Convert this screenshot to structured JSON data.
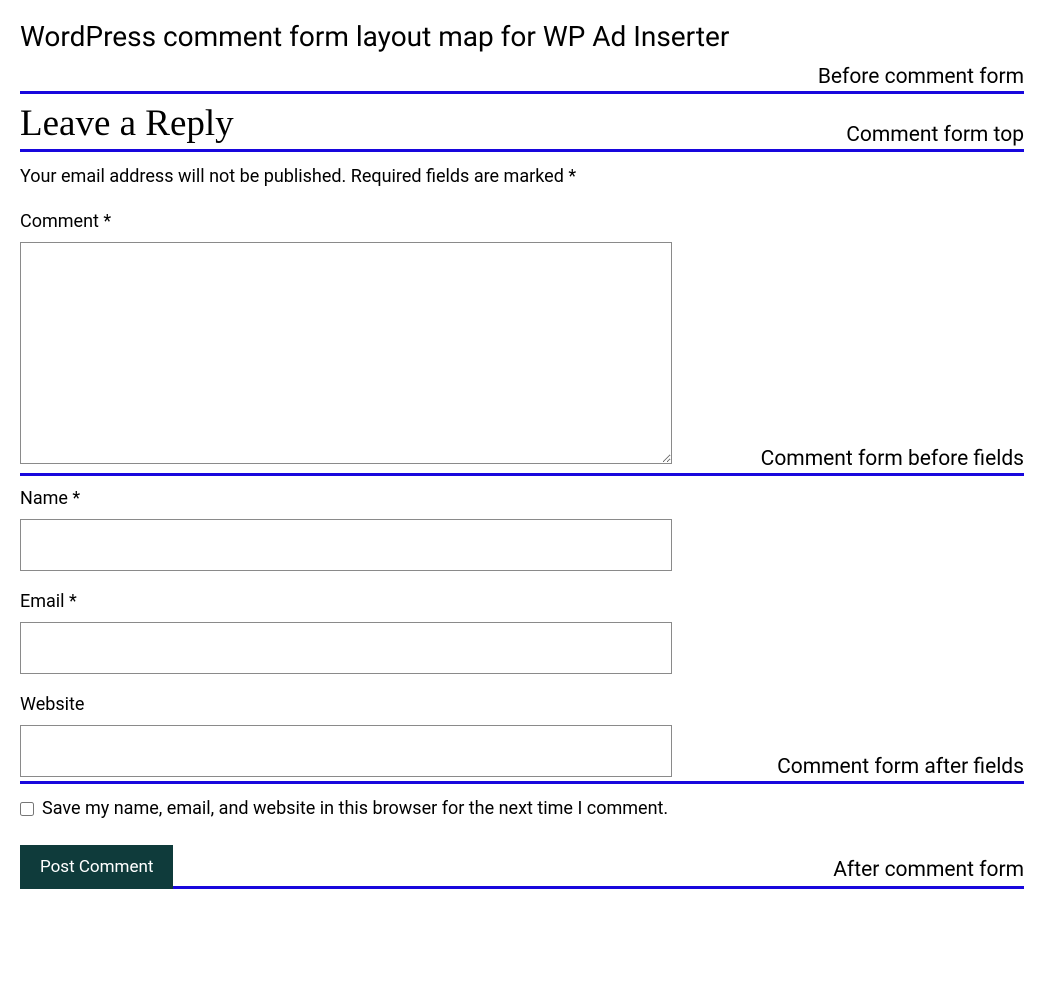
{
  "page_title": "WordPress comment form layout map for WP Ad Inserter",
  "markers": {
    "before_form": "Before comment form",
    "form_top": "Comment form top",
    "before_fields": "Comment form before fields",
    "after_fields": "Comment form after fields",
    "after_form": "After comment form"
  },
  "form": {
    "heading": "Leave a Reply",
    "email_note": "Your email address will not be published. Required fields are marked *",
    "comment_label": "Comment *",
    "name_label": "Name *",
    "email_label": "Email *",
    "website_label": "Website",
    "save_checkbox_label": "Save my name, email, and website in this browser for the next time I comment.",
    "submit_label": "Post Comment"
  }
}
